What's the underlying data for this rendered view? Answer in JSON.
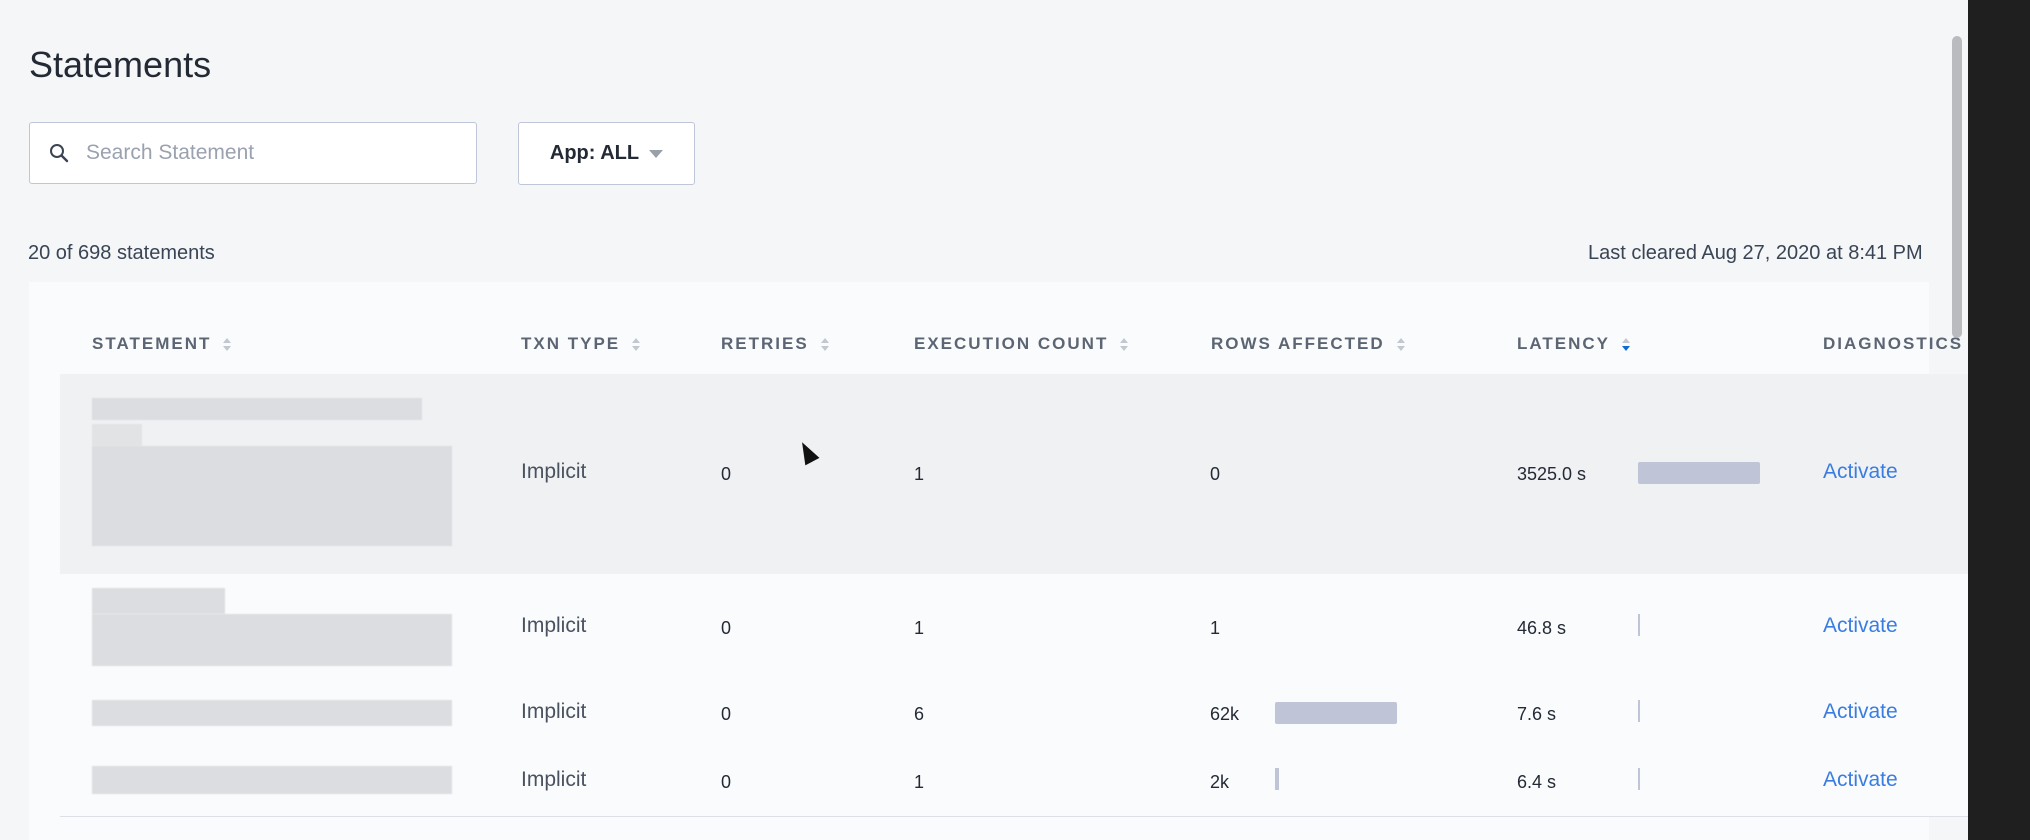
{
  "page": {
    "title": "Statements"
  },
  "search": {
    "placeholder": "Search Statement",
    "value": ""
  },
  "app_filter": {
    "label": "App: ALL"
  },
  "summary": {
    "count": "20 of 698 statements",
    "cleared": "Last cleared Aug 27, 2020 at 8:41 PM"
  },
  "table": {
    "columns": [
      "STATEMENT",
      "TXN TYPE",
      "RETRIES",
      "EXECUTION COUNT",
      "ROWS AFFECTED",
      "LATENCY",
      "DIAGNOSTICS"
    ],
    "sorted_column": "LATENCY",
    "sort_direction": "descending",
    "rows": [
      {
        "statement": "",
        "txn_type": "Implicit",
        "retries": "0",
        "execution_count": "1",
        "rows_affected": "0",
        "latency": "3525.0 s",
        "latency_bar_fraction": 1.0,
        "rows_bar_fraction": 0,
        "diagnostics": "Activate"
      },
      {
        "statement": "",
        "txn_type": "Implicit",
        "retries": "0",
        "execution_count": "1",
        "rows_affected": "1",
        "latency": "46.8 s",
        "latency_bar_fraction": 0.013,
        "rows_bar_fraction": 0,
        "diagnostics": "Activate"
      },
      {
        "statement": "",
        "txn_type": "Implicit",
        "retries": "0",
        "execution_count": "6",
        "rows_affected": "62k",
        "latency": "7.6 s",
        "latency_bar_fraction": 0.002,
        "rows_bar_fraction": 1.0,
        "diagnostics": "Activate"
      },
      {
        "statement": "",
        "txn_type": "Implicit",
        "retries": "0",
        "execution_count": "1",
        "rows_affected": "2k",
        "latency": "6.4 s",
        "latency_bar_fraction": 0.002,
        "rows_bar_fraction": 0.03,
        "diagnostics": "Activate"
      }
    ]
  },
  "colors": {
    "link": "#3a7de1",
    "bar": "#bfc4d6",
    "active_sort": "#0f6ad9",
    "border": "#c0c6d9"
  },
  "icons": {
    "search": "search-icon",
    "dropdown": "caret-down-icon",
    "sort": "sort-icon"
  }
}
